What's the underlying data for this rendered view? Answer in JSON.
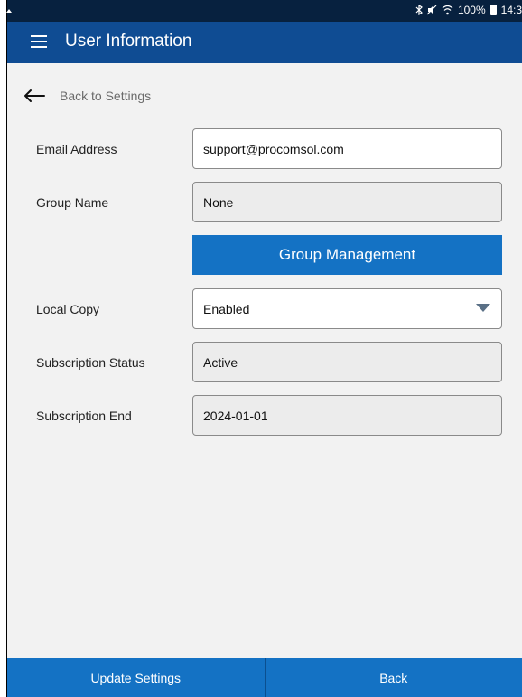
{
  "status_bar": {
    "left_icon": "image-notification-icon",
    "icons": [
      "bluetooth-icon",
      "mute-icon",
      "wifi-icon"
    ],
    "battery": "100%",
    "battery_icon": "battery-icon",
    "time": "14:3"
  },
  "app_bar": {
    "menu_icon": "hamburger-menu-icon",
    "title": "User Information",
    "background": "#0f4c93"
  },
  "back_link": {
    "icon": "arrow-left-icon",
    "label": "Back to Settings"
  },
  "form": {
    "email": {
      "label": "Email Address",
      "value": "support@procomsol.com"
    },
    "group": {
      "label": "Group Name",
      "value": "None"
    },
    "group_management_label": "Group Management",
    "local_copy": {
      "label": "Local Copy",
      "value": "Enabled",
      "icon": "dropdown-triangle-icon"
    },
    "subscription_status": {
      "label": "Subscription Status",
      "value": "Active"
    },
    "subscription_end": {
      "label": "Subscription End",
      "value": "2024-01-01"
    }
  },
  "bottom_bar": {
    "update_label": "Update Settings",
    "back_label": "Back",
    "background": "#1472c4"
  }
}
